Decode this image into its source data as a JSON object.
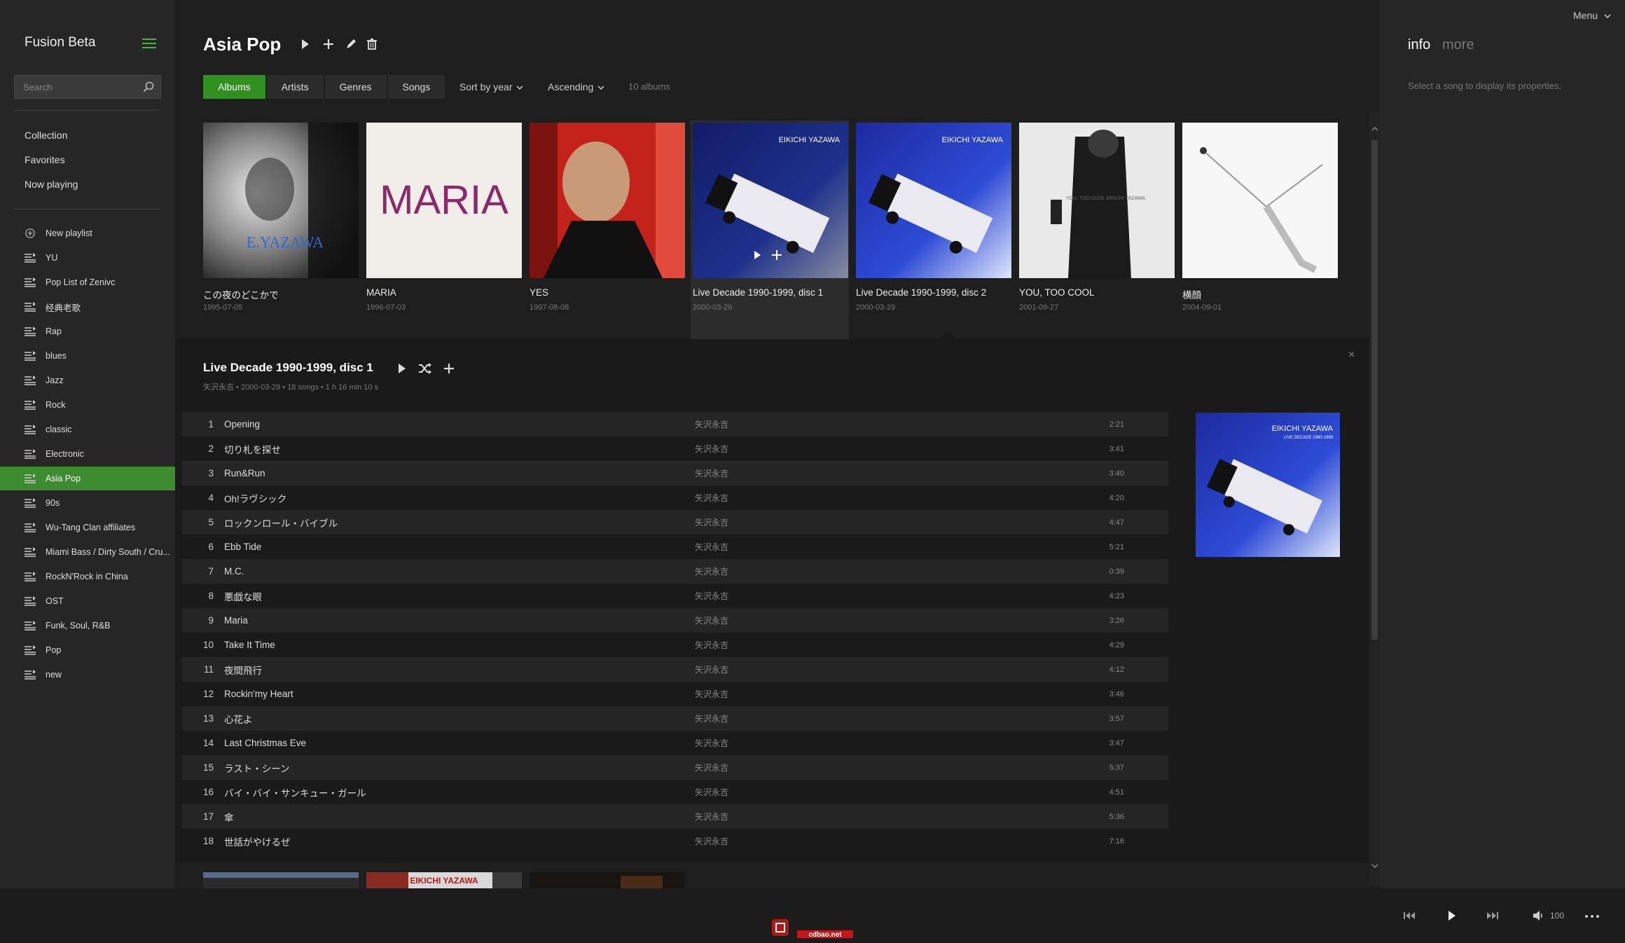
{
  "sidebar": {
    "app_title": "Fusion Beta",
    "search_placeholder": "Search",
    "nav": [
      "Collection",
      "Favorites",
      "Now playing"
    ],
    "new_playlist": "New playlist",
    "playlists": [
      "YU",
      "Pop List of Zenivc",
      "经典老歌",
      "Rap",
      "blues",
      "Jazz",
      "Rock",
      "classic",
      "Electronic",
      "Asia Pop",
      "90s",
      "Wu-Tang Clan affiliates",
      "Miami Bass / Dirty South / Cru...",
      "RockN'Rock in China",
      "OST",
      "Funk, Soul, R&B",
      "Pop",
      "new"
    ],
    "active_playlist": "Asia Pop"
  },
  "header": {
    "title": "Asia Pop",
    "tabs": [
      "Albums",
      "Artists",
      "Genres",
      "Songs"
    ],
    "active_tab": "Albums",
    "sort_label": "Sort by year",
    "order_label": "Ascending",
    "album_count": "10 albums"
  },
  "albums": [
    {
      "title": "この夜のどこかで",
      "date": "1995-07-05",
      "cover_text": "E.YAZAWA"
    },
    {
      "title": "MARIA",
      "date": "1996-07-03",
      "cover_text": "MARIA"
    },
    {
      "title": "YES",
      "date": "1997-08-08",
      "cover_text": ""
    },
    {
      "title": "Live Decade 1990-1999, disc 1",
      "date": "2000-03-29",
      "cover_text": "EIKICHI YAZAWA"
    },
    {
      "title": "Live Decade 1990-1999, disc 2",
      "date": "2000-03-29",
      "cover_text": "EIKICHI YAZAWA"
    },
    {
      "title": "YOU, TOO COOL",
      "date": "2001-09-27",
      "cover_text": "YOU, TOO COOL EIKICHI YAZAWA"
    },
    {
      "title": "横顔",
      "date": "2004-09-01",
      "cover_text": ""
    }
  ],
  "selected_album": 3,
  "detail": {
    "title": "Live Decade 1990-1999, disc 1",
    "meta": "矢沢永吉 • 2000-03-29 • 18 songs • 1 h 16 min 10 s",
    "close": "×",
    "cover_line1": "EIKICHI YAZAWA",
    "cover_line2": "LIVE DECADE 1990-1999",
    "tracks": [
      {
        "num": "1",
        "title": "Opening",
        "artist": "矢沢永吉",
        "duration": "2:21"
      },
      {
        "num": "2",
        "title": "切り札を探せ",
        "artist": "矢沢永吉",
        "duration": "3:41"
      },
      {
        "num": "3",
        "title": "Run&Run",
        "artist": "矢沢永吉",
        "duration": "3:40"
      },
      {
        "num": "4",
        "title": "Oh!ラヴシック",
        "artist": "矢沢永吉",
        "duration": "4:20"
      },
      {
        "num": "5",
        "title": "ロックンロール・バイブル",
        "artist": "矢沢永吉",
        "duration": "4:47"
      },
      {
        "num": "6",
        "title": "Ebb Tide",
        "artist": "矢沢永吉",
        "duration": "5:21"
      },
      {
        "num": "7",
        "title": "M.C.",
        "artist": "矢沢永吉",
        "duration": "0:39"
      },
      {
        "num": "8",
        "title": "悪戯な眼",
        "artist": "矢沢永吉",
        "duration": "4:23"
      },
      {
        "num": "9",
        "title": "Maria",
        "artist": "矢沢永吉",
        "duration": "3:26"
      },
      {
        "num": "10",
        "title": "Take It Time",
        "artist": "矢沢永吉",
        "duration": "4:29"
      },
      {
        "num": "11",
        "title": "夜間飛行",
        "artist": "矢沢永吉",
        "duration": "4:12"
      },
      {
        "num": "12",
        "title": "Rockin'my Heart",
        "artist": "矢沢永吉",
        "duration": "3:46"
      },
      {
        "num": "13",
        "title": "心花よ",
        "artist": "矢沢永吉",
        "duration": "3:57"
      },
      {
        "num": "14",
        "title": "Last Christmas Eve",
        "artist": "矢沢永吉",
        "duration": "3:47"
      },
      {
        "num": "15",
        "title": "ラスト・シーン",
        "artist": "矢沢永吉",
        "duration": "5:37"
      },
      {
        "num": "16",
        "title": "バイ・バイ・サンキュー・ガール",
        "artist": "矢沢永吉",
        "duration": "4:51"
      },
      {
        "num": "17",
        "title": "傘",
        "artist": "矢沢永吉",
        "duration": "5:36"
      },
      {
        "num": "18",
        "title": "世話がやけるぜ",
        "artist": "矢沢永吉",
        "duration": "7:16"
      }
    ]
  },
  "peek_cover_text": "EIKICHI YAZAWA",
  "info": {
    "tab_info": "info",
    "tab_more": "more",
    "hint": "Select a song to display its properties."
  },
  "menu_label": "Menu",
  "player": {
    "volume": "100",
    "icons": [
      "previous-icon",
      "play-icon",
      "next-icon",
      "volume-icon",
      "more-icon"
    ]
  },
  "watermark": {
    "text": "cdbao.net"
  },
  "colors": {
    "accent": "#3d8b2f",
    "tab_active": "#2f8f1f",
    "hamburger": "#52b043"
  }
}
